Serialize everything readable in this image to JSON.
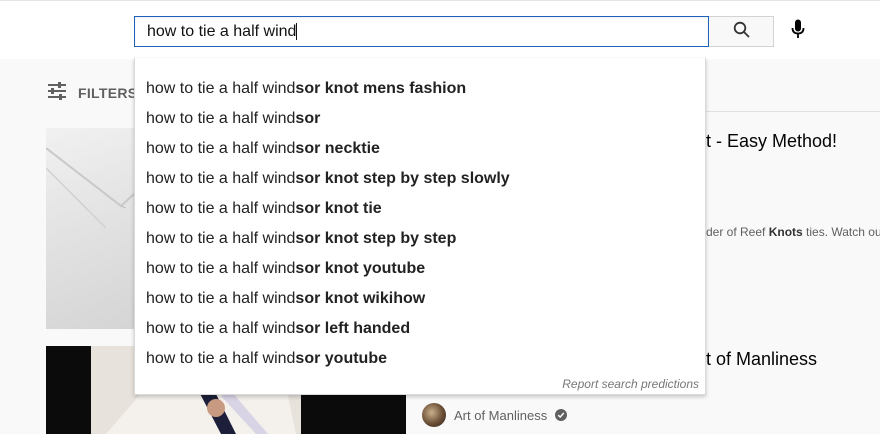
{
  "search": {
    "query": "how to tie a half wind"
  },
  "filters": {
    "label": "FILTERS"
  },
  "suggestions": {
    "items": [
      {
        "typed": "how to tie a half wind",
        "rest": "sor knot mens fashion"
      },
      {
        "typed": "how to tie a half wind",
        "rest": "sor"
      },
      {
        "typed": "how to tie a half wind",
        "rest": "sor necktie"
      },
      {
        "typed": "how to tie a half wind",
        "rest": "sor knot step by step slowly"
      },
      {
        "typed": "how to tie a half wind",
        "rest": "sor knot tie"
      },
      {
        "typed": "how to tie a half wind",
        "rest": "sor knot step by step"
      },
      {
        "typed": "how to tie a half wind",
        "rest": "sor knot youtube"
      },
      {
        "typed": "how to tie a half wind",
        "rest": "sor knot wikihow"
      },
      {
        "typed": "how to tie a half wind",
        "rest": "sor left handed"
      },
      {
        "typed": "how to tie a half wind",
        "rest": "sor youtube"
      }
    ],
    "report_label": "Report search predictions"
  },
  "results": [
    {
      "title_fragment": "t - Easy Method!",
      "desc_pre": "der of Reef ",
      "desc_bold": "Knots",
      "desc_post": " ties. Watch our"
    },
    {
      "title_fragment": "t of Manliness",
      "channel": "Art of Manliness"
    }
  ],
  "colors": {
    "accent_border": "#1c62b9",
    "background": "#f9f9f9",
    "secondary_text": "#606060"
  }
}
